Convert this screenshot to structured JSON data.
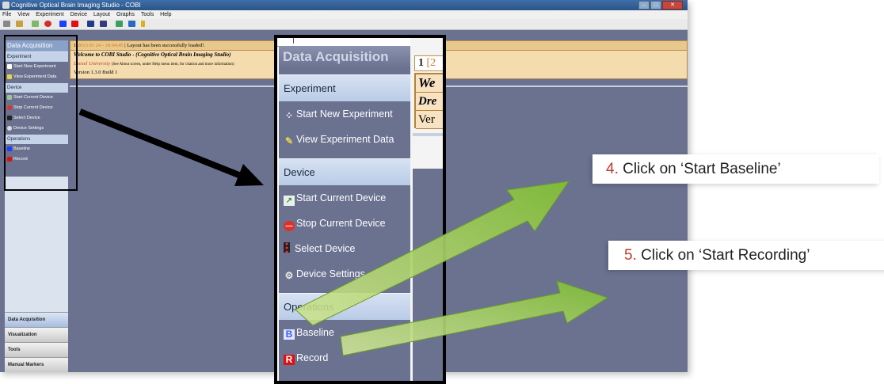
{
  "window": {
    "title": "Cognitive Optical Brain Imaging Studio - COBI",
    "menu": [
      "File",
      "View",
      "Experiment",
      "Device",
      "Layout",
      "Graphs",
      "Tools",
      "Help"
    ],
    "min_glyph": "–",
    "max_glyph": "□",
    "close_glyph": "✕"
  },
  "notification": {
    "index": "1",
    "timestamp": "2013 01 24 - 18:04:45",
    "status": "Layout has been successfully loaded!.",
    "welcome": "Welcome to COBI Studio - (Cognitive Optical Brain Imaging Studio)",
    "university": "Drexel University",
    "university_note": "(See About screen, under Help menu item, for citation and more information)",
    "version": "Version 1.3.0 Build 1"
  },
  "sidebar_small": {
    "title": "Data Acquisition",
    "groups": [
      {
        "label": "Experiment",
        "items": [
          "Start New Experiment",
          "View Experiment Data"
        ]
      },
      {
        "label": "Device",
        "items": [
          "Start Current Device",
          "Stop Current Device",
          "Select Device",
          "Device Settings"
        ]
      },
      {
        "label": "Operations",
        "items": [
          "Baseline",
          "Record"
        ]
      }
    ],
    "bottom_tabs": [
      "Data Acquisition",
      "Visualization",
      "Tools",
      "Manual Markers"
    ]
  },
  "zoom_panel": {
    "title": "Data Acquisition",
    "experiment_label": "Experiment",
    "start_new_experiment": "Start New Experiment",
    "view_experiment_data": "View Experiment Data",
    "device_label": "Device",
    "start_current_device": "Start Current Device",
    "stop_current_device": "Stop Current Device",
    "select_device": "Select Device",
    "device_settings": "Device Settings",
    "operations_label": "Operations",
    "baseline": "Baseline",
    "record": "Record",
    "notif_index": "1",
    "notif_bracket": "[2",
    "notif_we": "We",
    "notif_dre": "Dre",
    "notif_ver": "Ver"
  },
  "callouts": {
    "baseline_num": "4.",
    "baseline_text": " Click on ‘Start Baseline’",
    "record_num": "5.",
    "record_text": " Click on ‘Start Recording’"
  },
  "icons": {
    "start_experiment": "four-dots-icon",
    "view_data": "pencil-icon",
    "start_device": "chart-icon",
    "stop_device": "stop-sign-icon",
    "select_device": "traffic-light-icon",
    "settings": "gear-icon",
    "baseline": "letter-b-icon",
    "record": "letter-r-icon"
  },
  "colors": {
    "panel_bg": "#6b7290",
    "group_bg": "#c5d3e8",
    "notif_bg": "#f4dcae",
    "arrow_green": "#8dc63f",
    "callout_number": "#c0392b",
    "baseline_blue": "#1f3fff",
    "record_red": "#e01010"
  }
}
